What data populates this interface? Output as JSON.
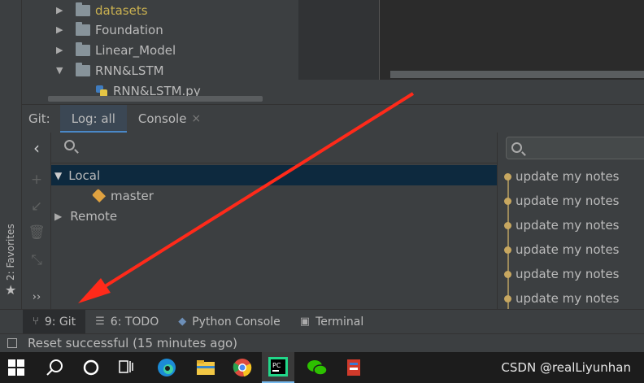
{
  "project_tree": {
    "items": [
      {
        "label": "datasets",
        "expanded": false,
        "type": "folder",
        "color": "#c9b050"
      },
      {
        "label": "Foundation",
        "expanded": false,
        "type": "folder"
      },
      {
        "label": "Linear_Model",
        "expanded": false,
        "type": "folder"
      },
      {
        "label": "RNN&LSTM",
        "expanded": true,
        "type": "folder"
      },
      {
        "label": "RNN&LSTM.py",
        "type": "python-file"
      }
    ]
  },
  "git_window": {
    "title": "Git:",
    "tabs": [
      {
        "label": "Log: all",
        "active": true
      },
      {
        "label": "Console",
        "active": false,
        "close": "×"
      }
    ],
    "toolbar_icons": [
      "back-icon",
      "add-icon",
      "checkout-icon",
      "delete-icon",
      "compare-icon",
      "more-icon"
    ],
    "more_label": "››"
  },
  "branches": {
    "local_label": "Local",
    "master_label": "master",
    "remote_label": "Remote"
  },
  "commits": [
    {
      "message": "update my notes"
    },
    {
      "message": "update my notes"
    },
    {
      "message": "update my notes"
    },
    {
      "message": "update my notes"
    },
    {
      "message": "update my notes"
    },
    {
      "message": "update my notes"
    }
  ],
  "left_strip": {
    "favorites_label": "2: Favorites"
  },
  "tool_tabs": [
    {
      "icon": "git-branch-icon",
      "label": "9: Git",
      "active": true
    },
    {
      "icon": "list-icon",
      "label": "6: TODO",
      "active": false
    },
    {
      "icon": "python-icon",
      "label": "Python Console",
      "active": false
    },
    {
      "icon": "terminal-icon",
      "label": "Terminal",
      "active": false
    }
  ],
  "status_bar": {
    "message": "Reset successful (15 minutes ago)"
  },
  "taskbar": {
    "watermark": "CSDN @realLiyunhan"
  },
  "colors": {
    "selection": "#0d293e",
    "accent": "#4a88c7",
    "commit_graph": "#c7a760",
    "annotation_arrow": "#ff2a1a"
  }
}
